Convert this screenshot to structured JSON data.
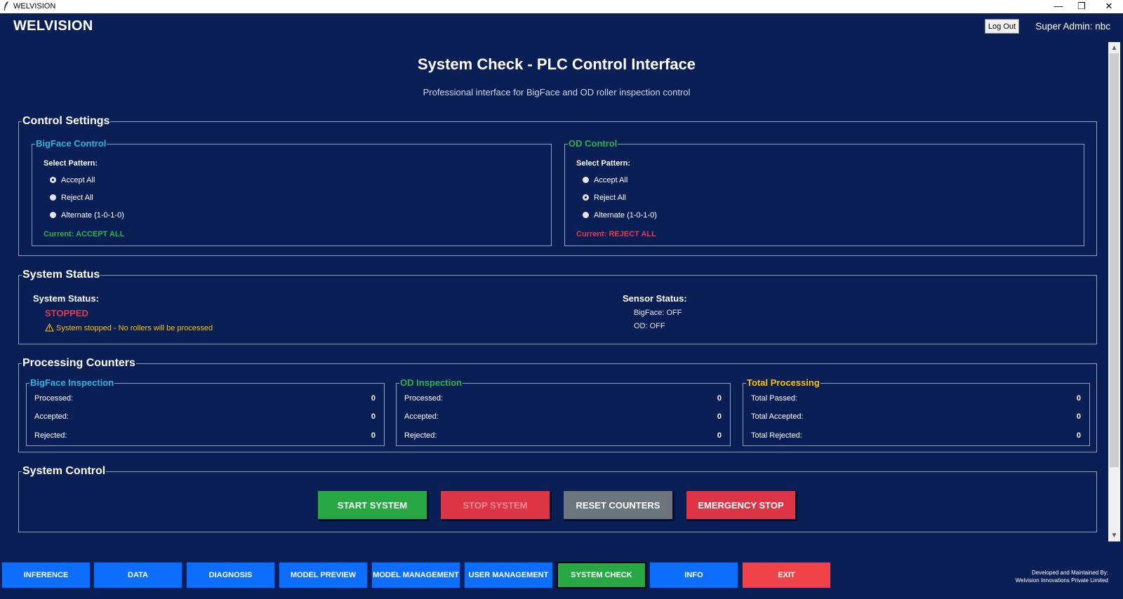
{
  "window": {
    "title": "WELVISION"
  },
  "header": {
    "app_name": "WELVISION",
    "logout_label": "Log Out",
    "user_label": "Super Admin: nbc"
  },
  "page": {
    "title": "System Check - PLC Control Interface",
    "subtitle": "Professional interface for BigFace and OD roller inspection control"
  },
  "control_settings": {
    "title": "Control Settings",
    "bigface": {
      "title": "BigFace Control",
      "select_label": "Select Pattern:",
      "options": [
        "Accept All",
        "Reject All",
        "Alternate (1-0-1-0)"
      ],
      "selected_index": 0,
      "current": "Current: ACCEPT ALL"
    },
    "od": {
      "title": "OD Control",
      "select_label": "Select Pattern:",
      "options": [
        "Accept All",
        "Reject All",
        "Alternate (1-0-1-0)"
      ],
      "selected_index": 1,
      "current": "Current: REJECT ALL"
    }
  },
  "system_status": {
    "title": "System Status",
    "status_label": "System Status:",
    "status_value": "STOPPED",
    "warning_icon": "warning-triangle-icon",
    "warning": "System stopped - No rollers will be processed",
    "sensor_label": "Sensor Status:",
    "sensor_bigface": "BigFace: OFF",
    "sensor_od": "OD: OFF"
  },
  "counters": {
    "title": "Processing Counters",
    "bigface": {
      "title": "BigFace Inspection",
      "rows": [
        {
          "label": "Processed:",
          "value": "0"
        },
        {
          "label": "Accepted:",
          "value": "0"
        },
        {
          "label": "Rejected:",
          "value": "0"
        }
      ]
    },
    "od": {
      "title": "OD Inspection",
      "rows": [
        {
          "label": "Processed:",
          "value": "0"
        },
        {
          "label": "Accepted:",
          "value": "0"
        },
        {
          "label": "Rejected:",
          "value": "0"
        }
      ]
    },
    "total": {
      "title": "Total Processing",
      "rows": [
        {
          "label": "Total Passed:",
          "value": "0"
        },
        {
          "label": "Total Accepted:",
          "value": "0"
        },
        {
          "label": "Total Rejected:",
          "value": "0"
        }
      ]
    }
  },
  "system_control": {
    "title": "System Control",
    "start": "START SYSTEM",
    "stop": "STOP SYSTEM",
    "reset": "RESET COUNTERS",
    "emergency": "EMERGENCY STOP"
  },
  "nav": {
    "items": [
      "INFERENCE",
      "DATA",
      "DIAGNOSIS",
      "MODEL PREVIEW",
      "MODEL MANAGEMENT",
      "USER MANAGEMENT",
      "SYSTEM CHECK",
      "INFO",
      "EXIT"
    ],
    "active": "SYSTEM CHECK"
  },
  "footer": {
    "credit_line1": "Developed and Maintained By:",
    "credit_line2": "Welvision Innovations Private Limited"
  },
  "colors": {
    "background": "#0b1f57",
    "accent_cyan": "#2fb5dc",
    "accent_green": "#28a745",
    "accent_red": "#dc3545",
    "accent_yellow": "#ffc107",
    "nav_blue": "#0d6efd"
  }
}
